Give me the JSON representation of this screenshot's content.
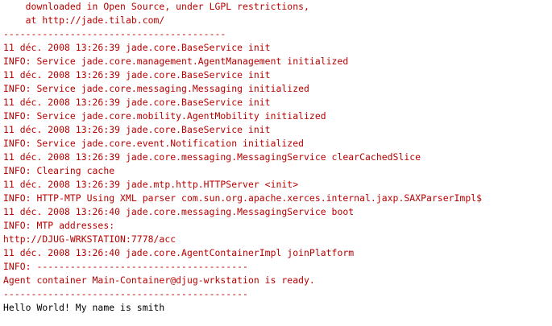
{
  "console": {
    "lines": [
      {
        "text": "    downloaded in Open Source, under LGPL restrictions,",
        "color": "red"
      },
      {
        "text": "    at http://jade.tilab.com/",
        "color": "red"
      },
      {
        "text": "----------------------------------------",
        "color": "red"
      },
      {
        "text": "11 déc. 2008 13:26:39 jade.core.BaseService init",
        "color": "red"
      },
      {
        "text": "INFO: Service jade.core.management.AgentManagement initialized",
        "color": "red"
      },
      {
        "text": "11 déc. 2008 13:26:39 jade.core.BaseService init",
        "color": "red"
      },
      {
        "text": "INFO: Service jade.core.messaging.Messaging initialized",
        "color": "red"
      },
      {
        "text": "11 déc. 2008 13:26:39 jade.core.BaseService init",
        "color": "red"
      },
      {
        "text": "INFO: Service jade.core.mobility.AgentMobility initialized",
        "color": "red"
      },
      {
        "text": "11 déc. 2008 13:26:39 jade.core.BaseService init",
        "color": "red"
      },
      {
        "text": "INFO: Service jade.core.event.Notification initialized",
        "color": "red"
      },
      {
        "text": "11 déc. 2008 13:26:39 jade.core.messaging.MessagingService clearCachedSlice",
        "color": "red"
      },
      {
        "text": "INFO: Clearing cache",
        "color": "red"
      },
      {
        "text": "11 déc. 2008 13:26:39 jade.mtp.http.HTTPServer <init>",
        "color": "red"
      },
      {
        "text": "INFO: HTTP-MTP Using XML parser com.sun.org.apache.xerces.internal.jaxp.SAXParserImpl$",
        "color": "red"
      },
      {
        "text": "11 déc. 2008 13:26:40 jade.core.messaging.MessagingService boot",
        "color": "red"
      },
      {
        "text": "INFO: MTP addresses:",
        "color": "red"
      },
      {
        "text": "http://DJUG-WRKSTATION:7778/acc",
        "color": "red"
      },
      {
        "text": "11 déc. 2008 13:26:40 jade.core.AgentContainerImpl joinPlatform",
        "color": "red"
      },
      {
        "text": "INFO: --------------------------------------",
        "color": "red"
      },
      {
        "text": "Agent container Main-Container@djug-wrkstation is ready.",
        "color": "red"
      },
      {
        "text": "--------------------------------------------",
        "color": "red"
      },
      {
        "text": "Hello World! My name is smith",
        "color": "black"
      }
    ]
  },
  "colors": {
    "red": "#b80000",
    "black": "#000000",
    "background": "#ffffff"
  }
}
